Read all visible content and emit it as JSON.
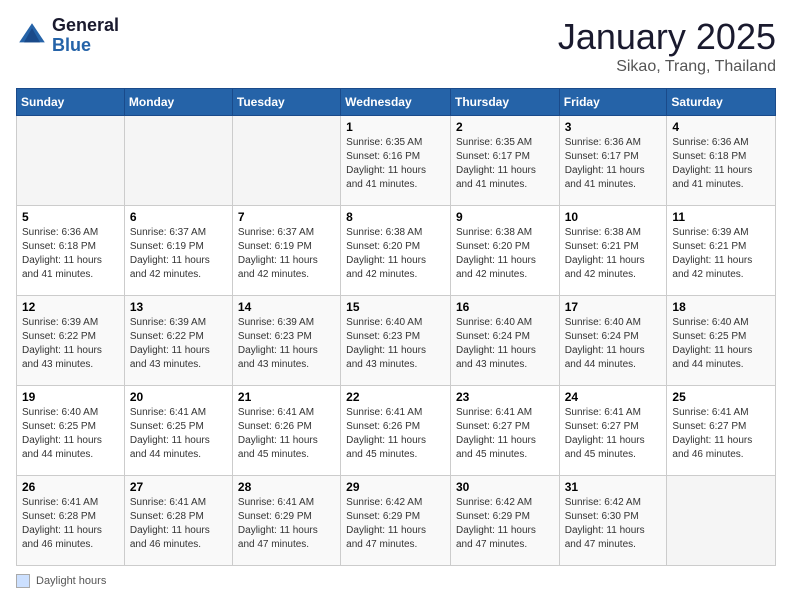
{
  "header": {
    "logo_line1": "General",
    "logo_line2": "Blue",
    "month": "January 2025",
    "location": "Sikao, Trang, Thailand"
  },
  "days_of_week": [
    "Sunday",
    "Monday",
    "Tuesday",
    "Wednesday",
    "Thursday",
    "Friday",
    "Saturday"
  ],
  "weeks": [
    [
      {
        "day": "",
        "info": ""
      },
      {
        "day": "",
        "info": ""
      },
      {
        "day": "",
        "info": ""
      },
      {
        "day": "1",
        "info": "Sunrise: 6:35 AM\nSunset: 6:16 PM\nDaylight: 11 hours and 41 minutes."
      },
      {
        "day": "2",
        "info": "Sunrise: 6:35 AM\nSunset: 6:17 PM\nDaylight: 11 hours and 41 minutes."
      },
      {
        "day": "3",
        "info": "Sunrise: 6:36 AM\nSunset: 6:17 PM\nDaylight: 11 hours and 41 minutes."
      },
      {
        "day": "4",
        "info": "Sunrise: 6:36 AM\nSunset: 6:18 PM\nDaylight: 11 hours and 41 minutes."
      }
    ],
    [
      {
        "day": "5",
        "info": "Sunrise: 6:36 AM\nSunset: 6:18 PM\nDaylight: 11 hours and 41 minutes."
      },
      {
        "day": "6",
        "info": "Sunrise: 6:37 AM\nSunset: 6:19 PM\nDaylight: 11 hours and 42 minutes."
      },
      {
        "day": "7",
        "info": "Sunrise: 6:37 AM\nSunset: 6:19 PM\nDaylight: 11 hours and 42 minutes."
      },
      {
        "day": "8",
        "info": "Sunrise: 6:38 AM\nSunset: 6:20 PM\nDaylight: 11 hours and 42 minutes."
      },
      {
        "day": "9",
        "info": "Sunrise: 6:38 AM\nSunset: 6:20 PM\nDaylight: 11 hours and 42 minutes."
      },
      {
        "day": "10",
        "info": "Sunrise: 6:38 AM\nSunset: 6:21 PM\nDaylight: 11 hours and 42 minutes."
      },
      {
        "day": "11",
        "info": "Sunrise: 6:39 AM\nSunset: 6:21 PM\nDaylight: 11 hours and 42 minutes."
      }
    ],
    [
      {
        "day": "12",
        "info": "Sunrise: 6:39 AM\nSunset: 6:22 PM\nDaylight: 11 hours and 43 minutes."
      },
      {
        "day": "13",
        "info": "Sunrise: 6:39 AM\nSunset: 6:22 PM\nDaylight: 11 hours and 43 minutes."
      },
      {
        "day": "14",
        "info": "Sunrise: 6:39 AM\nSunset: 6:23 PM\nDaylight: 11 hours and 43 minutes."
      },
      {
        "day": "15",
        "info": "Sunrise: 6:40 AM\nSunset: 6:23 PM\nDaylight: 11 hours and 43 minutes."
      },
      {
        "day": "16",
        "info": "Sunrise: 6:40 AM\nSunset: 6:24 PM\nDaylight: 11 hours and 43 minutes."
      },
      {
        "day": "17",
        "info": "Sunrise: 6:40 AM\nSunset: 6:24 PM\nDaylight: 11 hours and 44 minutes."
      },
      {
        "day": "18",
        "info": "Sunrise: 6:40 AM\nSunset: 6:25 PM\nDaylight: 11 hours and 44 minutes."
      }
    ],
    [
      {
        "day": "19",
        "info": "Sunrise: 6:40 AM\nSunset: 6:25 PM\nDaylight: 11 hours and 44 minutes."
      },
      {
        "day": "20",
        "info": "Sunrise: 6:41 AM\nSunset: 6:25 PM\nDaylight: 11 hours and 44 minutes."
      },
      {
        "day": "21",
        "info": "Sunrise: 6:41 AM\nSunset: 6:26 PM\nDaylight: 11 hours and 45 minutes."
      },
      {
        "day": "22",
        "info": "Sunrise: 6:41 AM\nSunset: 6:26 PM\nDaylight: 11 hours and 45 minutes."
      },
      {
        "day": "23",
        "info": "Sunrise: 6:41 AM\nSunset: 6:27 PM\nDaylight: 11 hours and 45 minutes."
      },
      {
        "day": "24",
        "info": "Sunrise: 6:41 AM\nSunset: 6:27 PM\nDaylight: 11 hours and 45 minutes."
      },
      {
        "day": "25",
        "info": "Sunrise: 6:41 AM\nSunset: 6:27 PM\nDaylight: 11 hours and 46 minutes."
      }
    ],
    [
      {
        "day": "26",
        "info": "Sunrise: 6:41 AM\nSunset: 6:28 PM\nDaylight: 11 hours and 46 minutes."
      },
      {
        "day": "27",
        "info": "Sunrise: 6:41 AM\nSunset: 6:28 PM\nDaylight: 11 hours and 46 minutes."
      },
      {
        "day": "28",
        "info": "Sunrise: 6:41 AM\nSunset: 6:29 PM\nDaylight: 11 hours and 47 minutes."
      },
      {
        "day": "29",
        "info": "Sunrise: 6:42 AM\nSunset: 6:29 PM\nDaylight: 11 hours and 47 minutes."
      },
      {
        "day": "30",
        "info": "Sunrise: 6:42 AM\nSunset: 6:29 PM\nDaylight: 11 hours and 47 minutes."
      },
      {
        "day": "31",
        "info": "Sunrise: 6:42 AM\nSunset: 6:30 PM\nDaylight: 11 hours and 47 minutes."
      },
      {
        "day": "",
        "info": ""
      }
    ]
  ],
  "legend": {
    "label": "Daylight hours"
  }
}
